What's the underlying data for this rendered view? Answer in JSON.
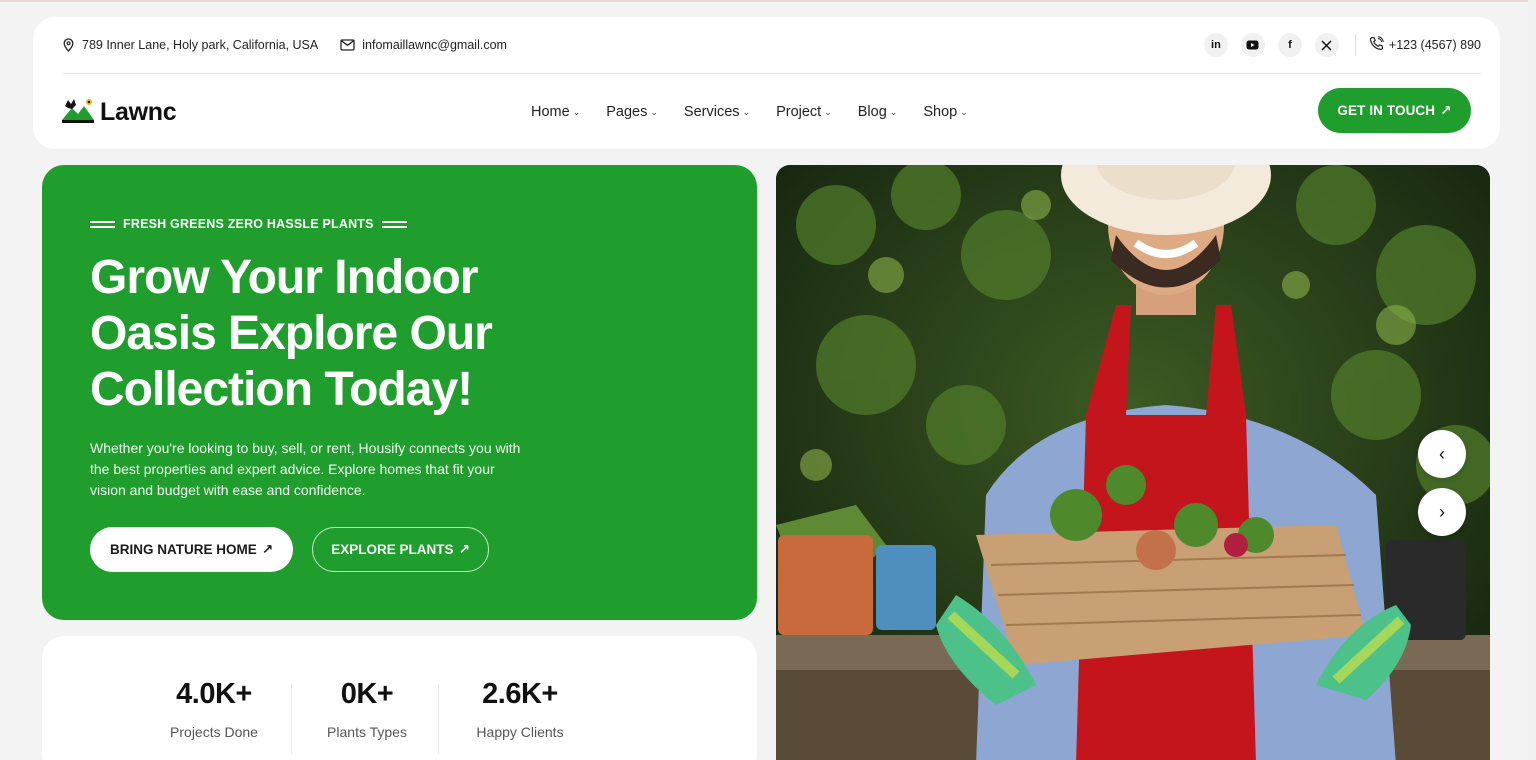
{
  "topbar": {
    "address": "789 Inner Lane, Holy park, California, USA",
    "email": "infomaillawnc@gmail.com",
    "social": [
      {
        "icon": "linkedin-icon",
        "glyph": "in"
      },
      {
        "icon": "youtube-icon",
        "glyph": "▶"
      },
      {
        "icon": "facebook-icon",
        "glyph": "f"
      },
      {
        "icon": "x-twitter-icon",
        "glyph": "𝕏"
      }
    ],
    "phone": "+123 (4567) 890"
  },
  "brand": {
    "name": "Lawnc"
  },
  "nav": {
    "items": [
      "Home",
      "Pages",
      "Services",
      "Project",
      "Blog",
      "Shop"
    ],
    "cta": "GET IN TOUCH"
  },
  "hero": {
    "kicker": "FRESH GREENS ZERO HASSLE PLANTS",
    "title_line1": "Grow Your Indoor",
    "title_line2": "Oasis Explore Our",
    "title_line3": "Collection Today!",
    "description": "Whether you're looking to buy, sell, or rent, Housify connects you with the best properties and expert advice. Explore homes that fit your vision and budget with ease and confidence.",
    "primary_button": "BRING NATURE HOME",
    "secondary_button": "EXPLORE PLANTS"
  },
  "stats": [
    {
      "value": "4.0K+",
      "label": "Projects Done"
    },
    {
      "value": "0K+",
      "label": "Plants Types"
    },
    {
      "value": "2.6K+",
      "label": "Happy Clients"
    }
  ],
  "colors": {
    "brand_green": "#1f9e2e",
    "background": "#f3f3f3",
    "card": "#ffffff"
  }
}
